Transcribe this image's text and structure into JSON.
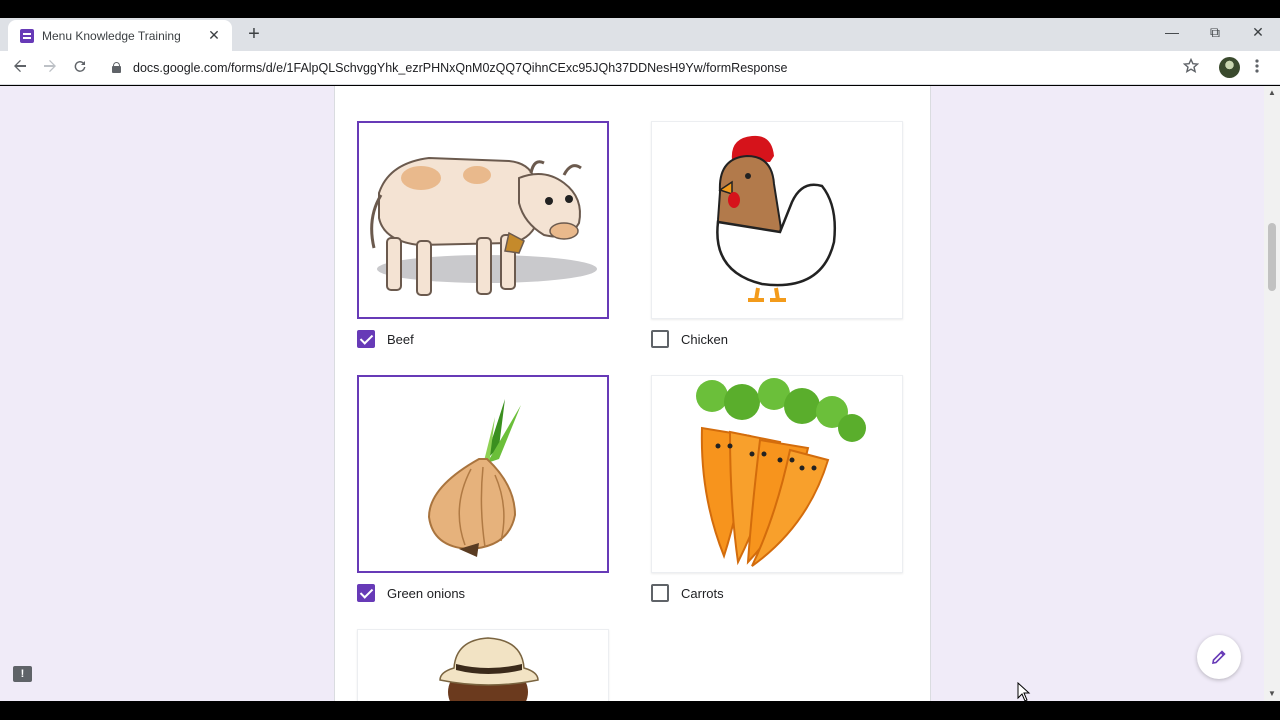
{
  "browser": {
    "tab_title": "Menu Knowledge Training",
    "tab_close": "✕",
    "new_tab": "+",
    "url": "docs.google.com/forms/d/e/1FAlpQLSchvggYhk_ezrPHNxQnM0zQQ7QihnCExc95JQh37DDNesH9Yw/formResponse",
    "window_minimize": "—",
    "window_restore": "⧉",
    "window_close": "✕"
  },
  "form": {
    "options": [
      {
        "label": "Beef",
        "checked": true,
        "icon": "cow-image"
      },
      {
        "label": "Chicken",
        "checked": false,
        "icon": "chicken-image"
      },
      {
        "label": "Green onions",
        "checked": true,
        "icon": "onion-image"
      },
      {
        "label": "Carrots",
        "checked": false,
        "icon": "carrots-image"
      },
      {
        "label": "",
        "checked": false,
        "icon": "cowboy-hat-image"
      }
    ]
  },
  "colors": {
    "accent": "#673ab7",
    "page_background": "#f0ebf8"
  }
}
